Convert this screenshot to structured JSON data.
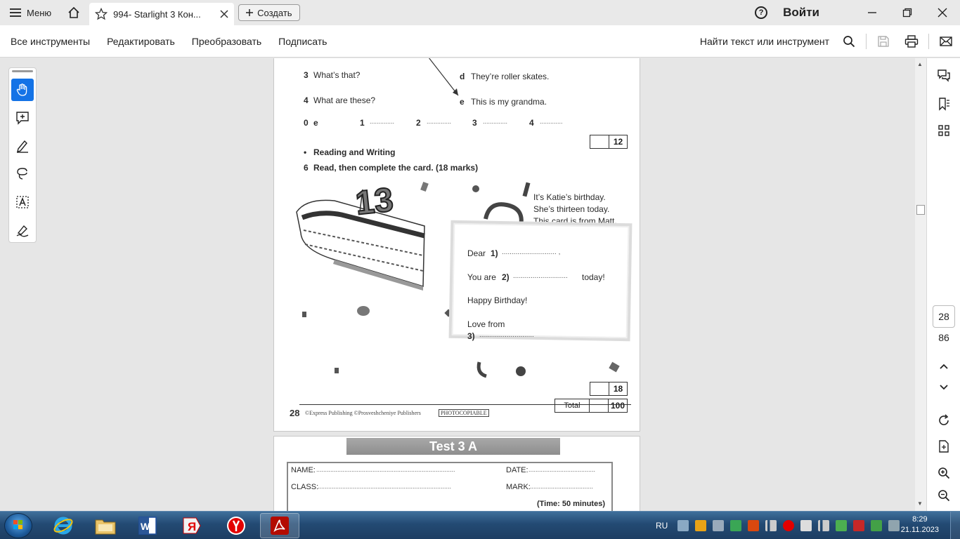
{
  "titlebar": {
    "menu_label": "Меню",
    "tab_title": "994- Starlight 3 Кон...",
    "create_label": "Создать",
    "login_label": "Войти"
  },
  "toolbar": {
    "all_tools": "Все инструменты",
    "edit": "Редактировать",
    "convert": "Преобразовать",
    "sign": "Подписать",
    "find_text": "Найти текст или инструмент"
  },
  "document": {
    "q3": "3",
    "q3_text": "What’s that?",
    "q4": "4",
    "q4_text": "What are these?",
    "ans_d": "d",
    "ans_d_text": "They’re roller skates.",
    "ans_e": "e",
    "ans_e_text": "This is my grandma.",
    "row_answers": {
      "n0": "0",
      "a0": "e",
      "n1": "1",
      "n2": "2",
      "n3": "3",
      "n4": "4",
      "blank": "..............",
      "blank_short": "............."
    },
    "score1": "12",
    "section_bullet": "•",
    "section_title": "Reading and Writing",
    "task_number": "6",
    "task_text": "Read, then complete the card. (18 marks)",
    "cake_number": "13",
    "info_lines": [
      "It’s Katie’s birthday.",
      "She’s thirteen today.",
      "This card is from Matt."
    ],
    "card": {
      "dear": "Dear",
      "num1": "1)",
      "dots1": "............................ ,",
      "you_are": "You are",
      "num2": "2)",
      "dots2": "............................",
      "today": "today!",
      "happy": "Happy Birthday!",
      "love": "Love from",
      "num3": "3)",
      "dots3": "............................"
    },
    "score2": "18",
    "total_label": "Total",
    "total_score": "100",
    "page_number": "28",
    "copyright": "©Express Publishing   ©Prosveshcheniye Publishers",
    "photocopiable": "PHOTOCOPIABLE",
    "test_title": "Test 3 A",
    "form": {
      "name": "NAME:",
      "name_dots": "...............................................................................",
      "date": "DATE:",
      "date_dots": "......................................",
      "class": "CLASS:",
      "class_dots": "............................................................................",
      "mark": "MARK:",
      "mark_dots": "....................................",
      "time": "(Time: 50 minutes)"
    }
  },
  "right_rail": {
    "current_page": "28",
    "total_pages": "86"
  },
  "taskbar": {
    "language": "RU",
    "time": "8:29",
    "date": "21.11.2023"
  },
  "colors": {
    "accent": "#1473e6",
    "adobe_red": "#b30b00",
    "taskbar": "#234a73"
  }
}
